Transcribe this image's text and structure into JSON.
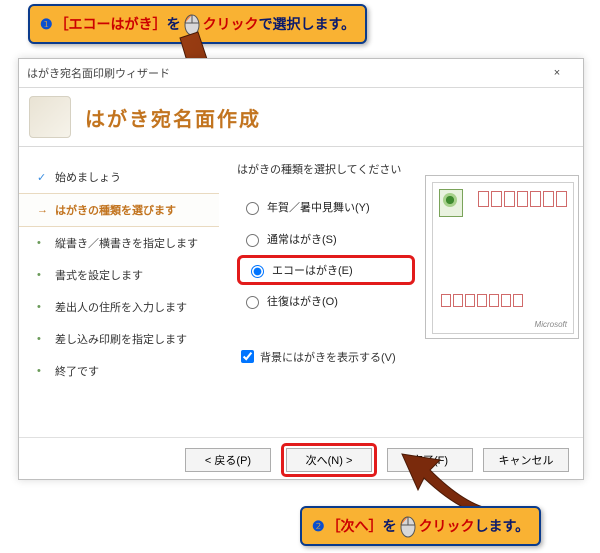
{
  "callout1": {
    "num": "❶",
    "part_a": "［エコーはがき］",
    "part_b": "を",
    "part_c": "クリック",
    "part_d": "で選択します。"
  },
  "callout2": {
    "num": "❷",
    "part_a": "［次へ］",
    "part_b": "を",
    "part_c": "クリック",
    "part_d": "します。"
  },
  "window": {
    "title": "はがき宛名面印刷ウィザード",
    "close": "×",
    "heading": "はがき宛名面作成"
  },
  "steps": [
    {
      "bullet": "✓",
      "label": "始めましょう",
      "state": "done"
    },
    {
      "bullet": "→",
      "label": "はがきの種類を選びます",
      "state": "active"
    },
    {
      "bullet": "•",
      "label": "縦書き／横書きを指定します",
      "state": ""
    },
    {
      "bullet": "•",
      "label": "書式を設定します",
      "state": ""
    },
    {
      "bullet": "•",
      "label": "差出人の住所を入力します",
      "state": ""
    },
    {
      "bullet": "•",
      "label": "差し込み印刷を指定します",
      "state": ""
    },
    {
      "bullet": "•",
      "label": "終了です",
      "state": ""
    }
  ],
  "options": {
    "prompt": "はがきの種類を選択してください",
    "radios": [
      {
        "label": "年賀／暑中見舞い(Y)",
        "checked": false
      },
      {
        "label": "通常はがき(S)",
        "checked": false
      },
      {
        "label": "エコーはがき(E)",
        "checked": true
      },
      {
        "label": "往復はがき(O)",
        "checked": false
      }
    ],
    "bgcheck_label": "背景にはがきを表示する(V)",
    "bgcheck_checked": true
  },
  "preview": {
    "brand": "Microsoft"
  },
  "buttons": {
    "back": "< 戻る(P)",
    "next": "次へ(N) >",
    "finish": "完了(F)",
    "cancel": "キャンセル"
  }
}
